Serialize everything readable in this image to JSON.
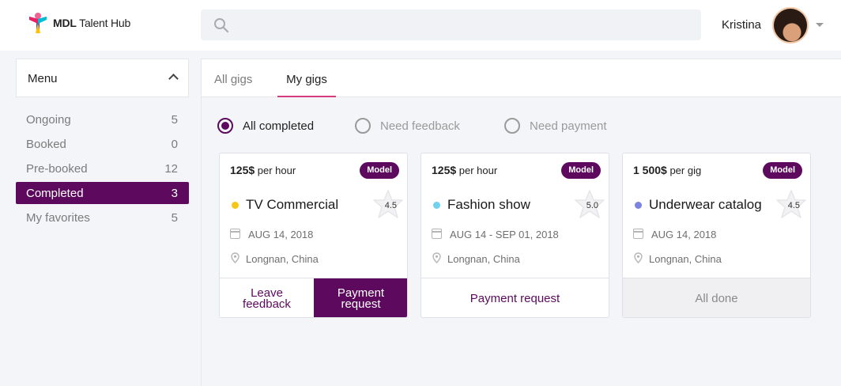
{
  "header": {
    "logo_bold": "MDL",
    "logo_rest": " Talent Hub",
    "user_name": "Kristina"
  },
  "sidebar": {
    "menu_title": "Menu",
    "items": [
      {
        "label": "Ongoing",
        "count": "5"
      },
      {
        "label": "Booked",
        "count": "0"
      },
      {
        "label": "Pre-booked",
        "count": "12"
      },
      {
        "label": "Completed",
        "count": "3"
      },
      {
        "label": "My favorites",
        "count": "5"
      }
    ]
  },
  "tabs": {
    "all": "All gigs",
    "my": "My gigs"
  },
  "filters": {
    "all_completed": "All completed",
    "need_feedback": "Need feedback",
    "need_payment": "Need payment"
  },
  "cards": [
    {
      "price": "125$",
      "unit": "per hour",
      "badge": "Model",
      "title": "TV Commercial",
      "rating": "4.5",
      "date": "AUG 14, 2018",
      "location": "Longnan, China",
      "dot_color": "#f5c518",
      "action_left": "Leave feedback",
      "action_right": "Payment request"
    },
    {
      "price": "125$",
      "unit": "per hour",
      "badge": "Model",
      "title": "Fashion show",
      "rating": "5.0",
      "date": "AUG 14 - SEP 01, 2018",
      "location": "Longnan, China",
      "dot_color": "#6fd0f0",
      "action": "Payment request"
    },
    {
      "price": "1 500$",
      "unit": "per gig",
      "badge": "Model",
      "title": "Underwear catalog",
      "rating": "4.5",
      "date": "AUG 14, 2018",
      "location": "Longnan, China",
      "dot_color": "#7b85e0",
      "action": "All done"
    }
  ],
  "colors": {
    "accent": "#5d0a5e",
    "tab_underline": "#d63a7f"
  }
}
